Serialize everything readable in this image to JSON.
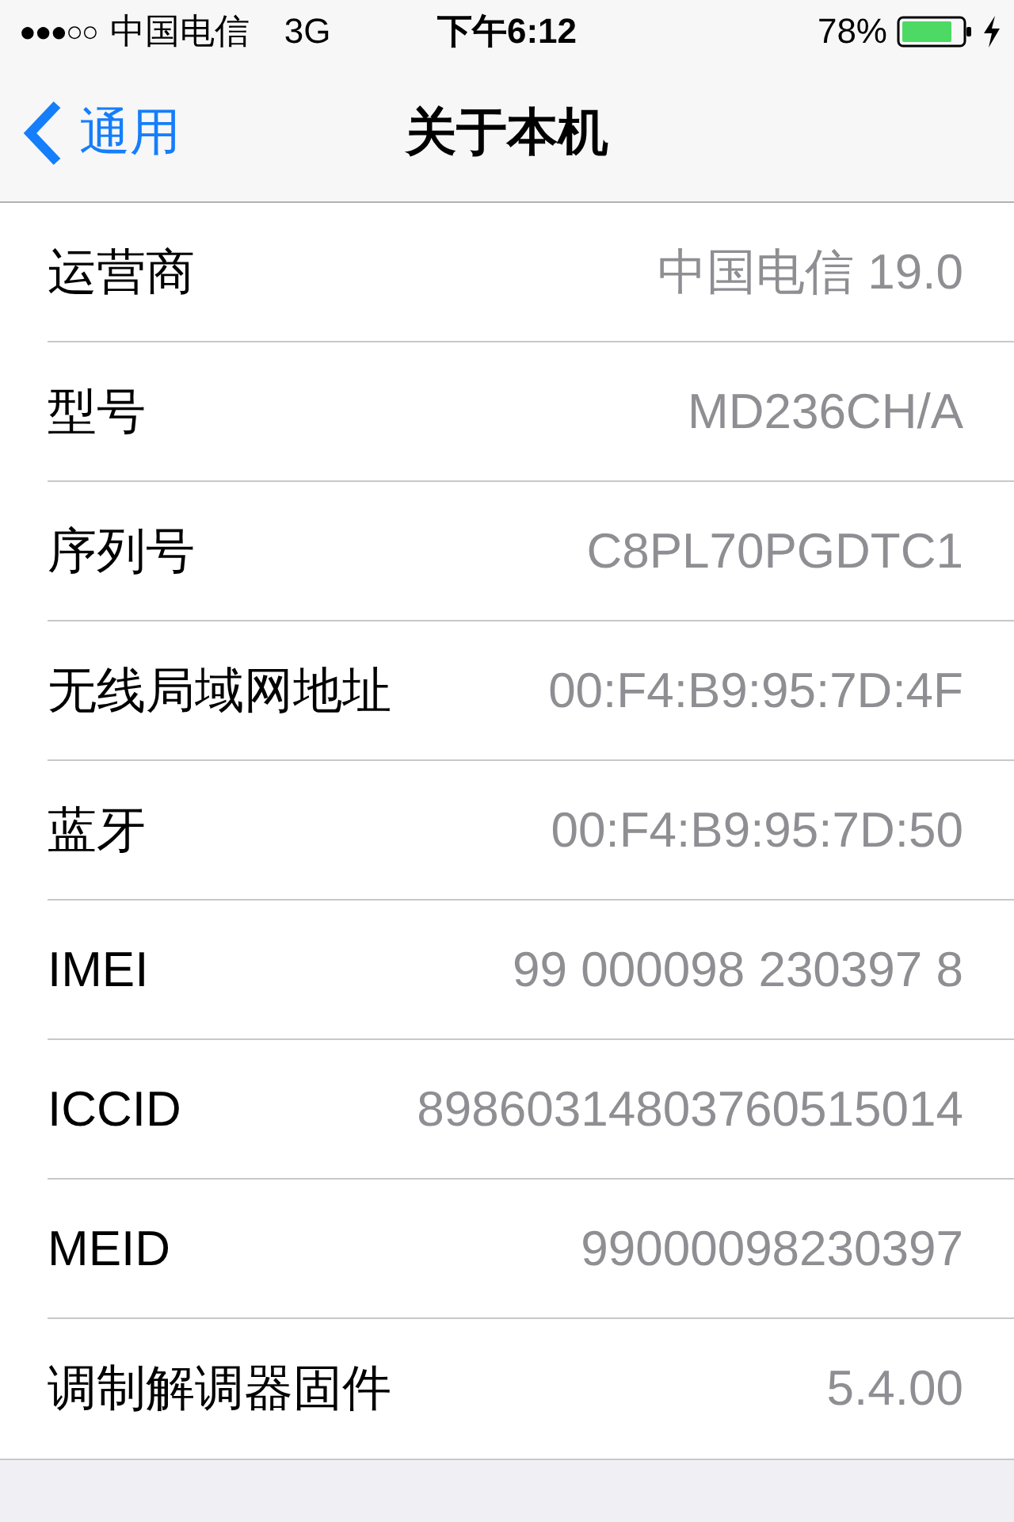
{
  "status_bar": {
    "signal": "●●●○○",
    "carrier": "中国电信",
    "network": "3G",
    "time": "下午6:12",
    "battery": "78%"
  },
  "nav_bar": {
    "back": "通用",
    "title": "关于本机"
  },
  "rows": [
    {
      "label": "运营商",
      "value": "中国电信 19.0"
    },
    {
      "label": "型号",
      "value": "MD236CH/A"
    },
    {
      "label": "序列号",
      "value": "C8PL70PGDTC1"
    },
    {
      "label": "无线局域网地址",
      "value": "00:F4:B9:95:7D:4F"
    },
    {
      "label": "蓝牙",
      "value": "00:F4:B9:95:7D:50"
    },
    {
      "label": "IMEI",
      "value": "99 000098 230397 8"
    },
    {
      "label": "ICCID",
      "value": "89860314803760515014"
    },
    {
      "label": "MEID",
      "value": "99000098230397"
    },
    {
      "label": "调制解调器固件",
      "value": "5.4.00"
    }
  ]
}
